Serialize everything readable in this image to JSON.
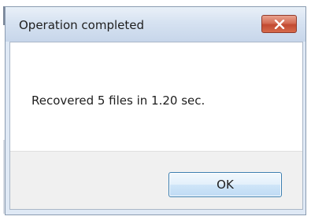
{
  "window": {
    "title": "Operation completed",
    "close_icon": "close-icon"
  },
  "content": {
    "message": "Recovered 5 files in 1.20 sec."
  },
  "footer": {
    "ok_label": "OK"
  },
  "colors": {
    "titlebar": "#d6e2f1",
    "close_button": "#d46d55",
    "ok_border": "#3c7fb1",
    "footer_bg": "#f0f0f0"
  }
}
